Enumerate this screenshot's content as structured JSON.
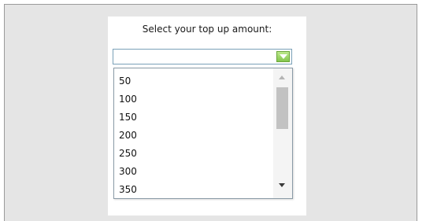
{
  "prompt": "Select your top up amount:",
  "combo": {
    "value": "",
    "open": true
  },
  "options": [
    "50",
    "100",
    "150",
    "200",
    "250",
    "300",
    "350"
  ],
  "colors": {
    "background": "#e5e5e5",
    "panel": "#ffffff",
    "combo_border": "#7aa0b8",
    "dropdown_button": "#84c64d"
  },
  "icons": {
    "dropdown": "chevron-down-icon",
    "scroll_up": "scroll-up-arrow-icon",
    "scroll_down": "scroll-down-arrow-icon"
  }
}
